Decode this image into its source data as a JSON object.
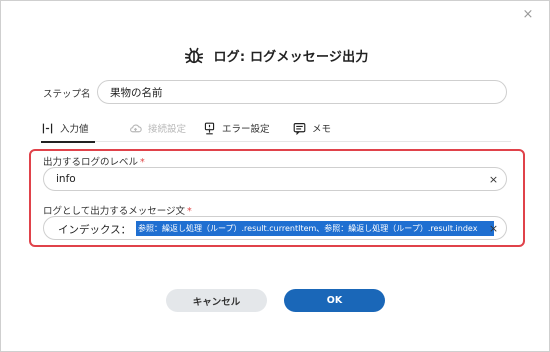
{
  "dialog": {
    "close_glyph": "×",
    "title": "ログ: ログメッセージ出力",
    "title_icon": "bug-icon"
  },
  "step_name": {
    "label": "ステップ名",
    "value": "果物の名前"
  },
  "tabs": [
    {
      "label": "入力値",
      "icon": "input-tab-icon",
      "active": true,
      "disabled": false
    },
    {
      "label": "接続設定",
      "icon": "cloud-icon",
      "active": false,
      "disabled": true
    },
    {
      "label": "エラー設定",
      "icon": "error-settings-icon",
      "active": false,
      "disabled": false
    },
    {
      "label": "メモ",
      "icon": "memo-icon",
      "active": false,
      "disabled": false
    }
  ],
  "log_level": {
    "label": "出力するログのレベル",
    "required_mark": "*",
    "value": "info",
    "clear_glyph": "×"
  },
  "log_message": {
    "label": "ログとして出力するメッセージ文",
    "required_mark": "*",
    "prefix": "インデックス：",
    "selected_text": "参照：繰返し処理（ループ）.result.currentItem、参照：繰返し処理（ループ）.result.index",
    "clear_glyph": "×"
  },
  "buttons": {
    "cancel": "キャンセル",
    "ok": "OK"
  },
  "colors": {
    "highlight": "#e0424a",
    "primary": "#1a67b8",
    "selection": "#1f6fd1"
  }
}
